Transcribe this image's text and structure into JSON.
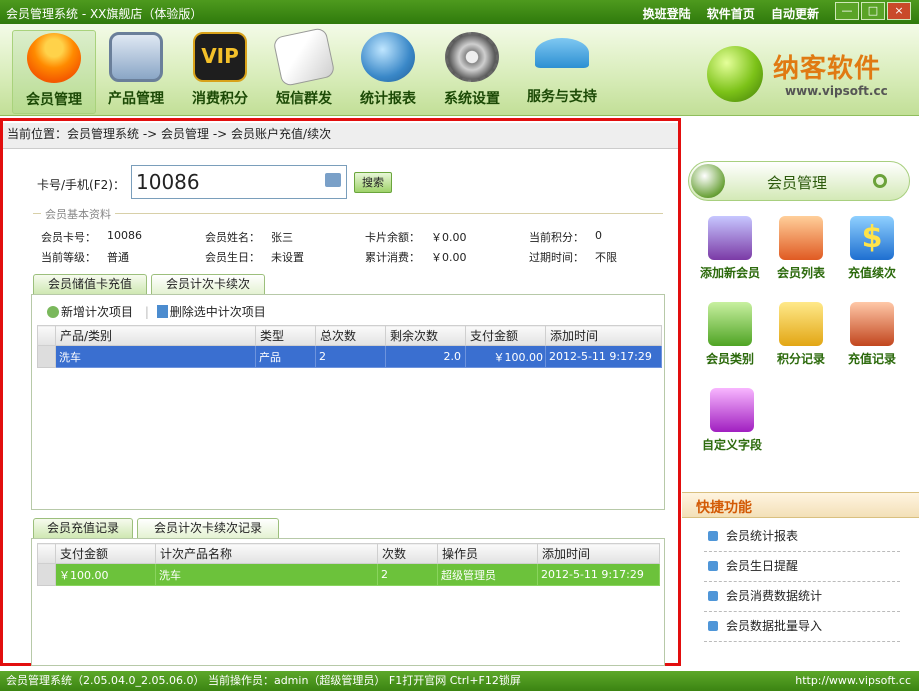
{
  "window": {
    "title": "会员管理系统 - XX旗舰店（体验版）",
    "links": [
      "换班登陆",
      "软件首页",
      "自动更新"
    ],
    "controls": [
      "—",
      "□",
      "×"
    ]
  },
  "toolbar": {
    "items": [
      "会员管理",
      "产品管理",
      "消费积分",
      "短信群发",
      "统计报表",
      "系统设置",
      "服务与支持"
    ]
  },
  "logo": {
    "name": "纳客软件",
    "url": "www.vipsoft.cc"
  },
  "breadcrumb": "当前位置：会员管理系统 -> 会员管理 -> 会员账户充值/续次",
  "search": {
    "label": "卡号/手机(F2)：",
    "value": "10086",
    "button": "搜索"
  },
  "basic": {
    "group_title": "会员基本资料",
    "fields": [
      {
        "label": "会员卡号：",
        "value": "10086"
      },
      {
        "label": "会员姓名：",
        "value": "张三"
      },
      {
        "label": "卡片余额：",
        "value": "￥0.00"
      },
      {
        "label": "当前积分：",
        "value": "0"
      },
      {
        "label": "当前等级：",
        "value": "普通"
      },
      {
        "label": "会员生日：",
        "value": "未设置"
      },
      {
        "label": "累计消费：",
        "value": "￥0.00"
      },
      {
        "label": "过期时间：",
        "value": "不限"
      }
    ]
  },
  "tabs1": [
    "会员储值卡充值",
    "会员计次卡续次"
  ],
  "actions": {
    "add": "新增计次项目",
    "del": "删除选中计次项目"
  },
  "table1": {
    "headers": [
      "产品/类别",
      "类型",
      "总次数",
      "剩余次数",
      "支付金额",
      "添加时间"
    ],
    "rows": [
      [
        "洗车",
        "产品",
        "2",
        "2.0",
        "￥100.00",
        "2012-5-11  9:17:29"
      ]
    ]
  },
  "tabs2": [
    "会员充值记录",
    "会员计次卡续次记录"
  ],
  "table2": {
    "headers": [
      "支付金额",
      "计次产品名称",
      "次数",
      "操作员",
      "添加时间"
    ],
    "rows": [
      [
        "￥100.00",
        "洗车",
        "2",
        "超级管理员",
        "2012-5-11  9:17:29"
      ]
    ]
  },
  "side": {
    "title": "会员管理",
    "items": [
      "添加新会员",
      "会员列表",
      "充值续次",
      "会员类别",
      "积分记录",
      "充值记录",
      "自定义字段"
    ],
    "quick_title": "快捷功能",
    "quick_items": [
      "会员统计报表",
      "会员生日提醒",
      "会员消费数据统计",
      "会员数据批量导入"
    ]
  },
  "status": {
    "left": "会员管理系统（2.05.04.0_2.05.06.0） 当前操作员：admin（超级管理员） F1打开官网 Ctrl+F12锁屏",
    "right": "http://www.vipsoft.cc"
  }
}
